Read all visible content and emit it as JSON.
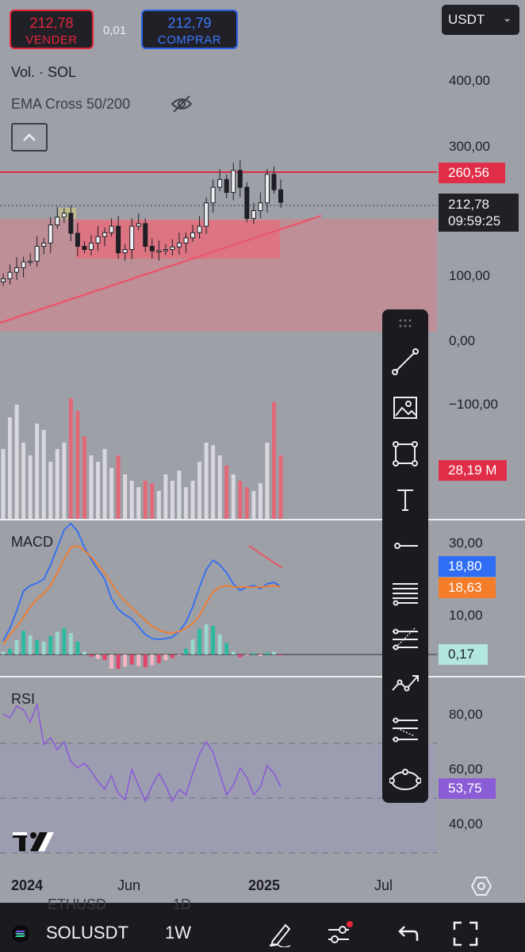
{
  "trade": {
    "sell_price": "212,78",
    "sell_label": "VENDER",
    "spread": "0,01",
    "buy_price": "212,79",
    "buy_label": "COMPRAR",
    "currency": "USDT"
  },
  "indicators": {
    "volume_label": "Vol. · SOL",
    "ema_label": "EMA Cross 50/200",
    "macd_label": "MACD",
    "rsi_label": "RSI"
  },
  "price_axis": [
    "400,00",
    "300,00",
    "100,00",
    "0,00",
    "−100,00"
  ],
  "macd_axis": [
    "30,00",
    "10,00"
  ],
  "rsi_axis": [
    "80,00",
    "60,00",
    "40,00"
  ],
  "tags": {
    "resistance": "260,56",
    "last_price": "212,78",
    "countdown": "09:59:25",
    "volume": "28,19 M",
    "macd_line": "18,80",
    "signal_line": "18,63",
    "histogram": "0,17",
    "rsi": "53,75"
  },
  "colors": {
    "sell": "#e6263c",
    "buy": "#2b63e6",
    "resistance": "#e02d48",
    "macd": "#2f6df5",
    "signal": "#f57c28",
    "rsi": "#8a5cd6",
    "histogram_tag": "#b2e6df"
  },
  "time_axis": [
    "2024",
    "Jun",
    "2025",
    "Jul"
  ],
  "bottom": {
    "symbol": "SOLUSDT",
    "interval": "1W",
    "partial_ticker_left": "ETHUSD",
    "partial_ticker_right": "1D"
  },
  "tools": [
    "trend-line-icon",
    "image-icon",
    "rectangle-icon",
    "text-icon",
    "horizontal-ray-icon",
    "parallel-channel-icon",
    "pitchfork-icon",
    "path-icon",
    "fib-retracement-icon",
    "ellipse-icon"
  ],
  "chart_data": {
    "type": "line",
    "title": "",
    "xlabel": "",
    "ylabel": "",
    "x": [
      "2024",
      "Jun",
      "2025",
      "Jul"
    ],
    "ylim": [
      -100,
      400
    ],
    "series": [
      {
        "values": [
          95,
          105,
          112,
          121,
          122,
          145,
          150,
          178,
          190,
          196,
          165,
          145,
          140,
          150,
          160,
          166,
          176,
          135,
          140,
          176,
          180,
          145,
          138,
          138,
          140,
          144,
          150,
          158,
          166,
          176,
          212,
          236,
          248,
          228,
          262,
          236,
          188,
          200,
          212,
          256,
          232,
          212.78
        ]
      }
    ],
    "current_price": 212.78,
    "resistance_level": 260.56,
    "volume_last": "28,19 M",
    "macd": {
      "macd": 18.8,
      "signal": 18.63,
      "histogram": 0.17
    },
    "rsi": 53.75
  }
}
